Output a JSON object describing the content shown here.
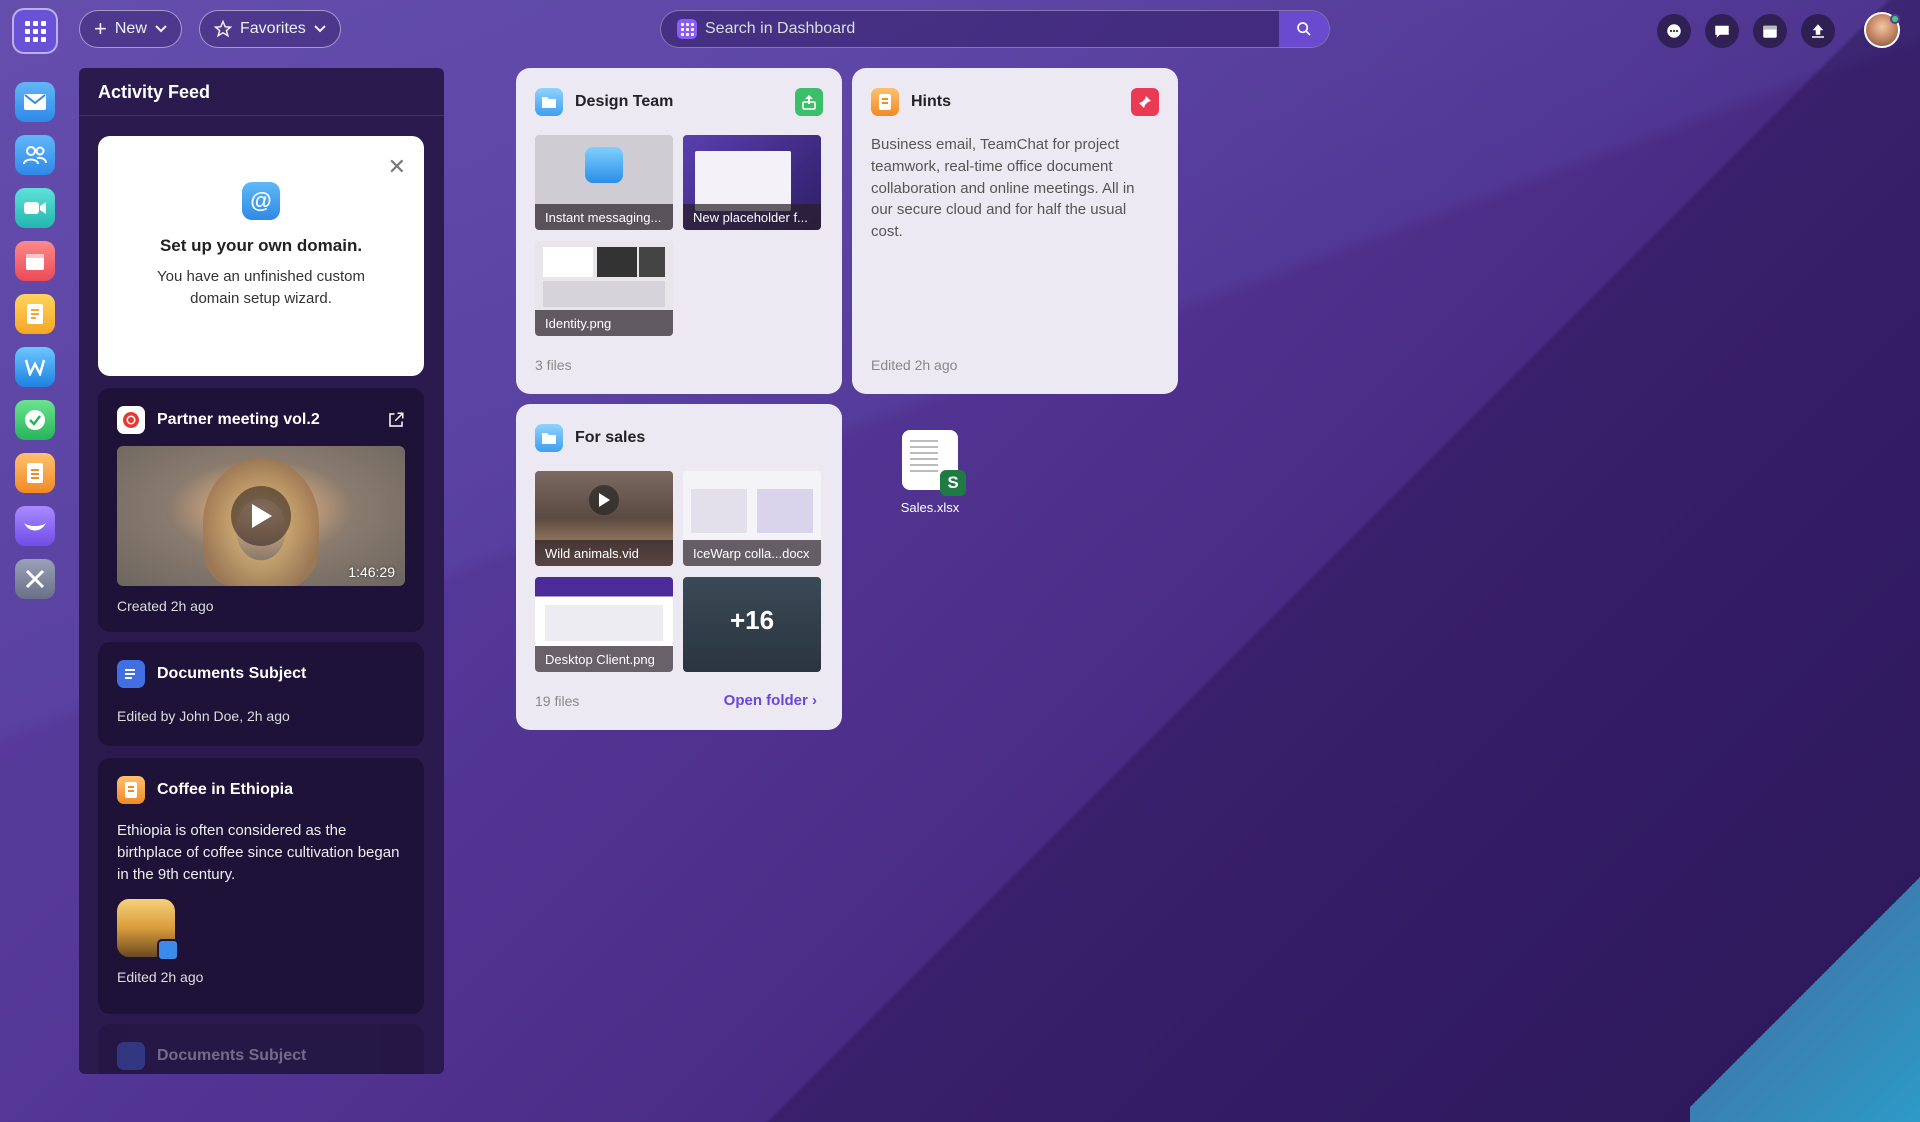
{
  "topbar": {
    "new_label": "New",
    "favorites_label": "Favorites",
    "search_placeholder": "Search in Dashboard"
  },
  "dock": {
    "items": [
      "mail",
      "contacts",
      "video",
      "calendar",
      "notes",
      "documents",
      "tasks",
      "files",
      "teamchat",
      "tools"
    ]
  },
  "feed": {
    "title": "Activity Feed",
    "domain_card": {
      "title": "Set up your own domain.",
      "text": "You have an unfinished custom domain setup wizard."
    },
    "meeting": {
      "title": "Partner meeting vol.2",
      "duration": "1:46:29",
      "meta": "Created 2h ago"
    },
    "documents": {
      "title": "Documents Subject",
      "meta": "Edited by John Doe, 2h ago"
    },
    "coffee": {
      "title": "Coffee in Ethiopia",
      "text": "Ethiopia is often considered as the birthplace of coffee since cultivation began in the 9th century.",
      "meta": "Edited 2h ago"
    },
    "documents2": {
      "title": "Documents Subject"
    }
  },
  "design_team": {
    "title": "Design Team",
    "files": [
      "Instant messaging...",
      "New placeholder f...",
      "Identity.png"
    ],
    "footer": "3 files"
  },
  "hints": {
    "title": "Hints",
    "text": "Business email, TeamChat for project teamwork, real-time office document collaboration and online meetings. All in our secure cloud and for half the usual cost.",
    "footer": "Edited 2h ago"
  },
  "for_sales": {
    "title": "For sales",
    "files": [
      "Wild animals.vid",
      "IceWarp colla...docx",
      "Desktop Client.png"
    ],
    "more": "+16",
    "footer": "19 files",
    "open_folder": "Open folder"
  },
  "desktop_file": {
    "name": "Sales.xlsx",
    "badge": "S"
  },
  "colors": {
    "accent": "#6a46d6",
    "panel": "#2a1a4e",
    "card": "#1e1238",
    "widget": "#ede9f3"
  }
}
